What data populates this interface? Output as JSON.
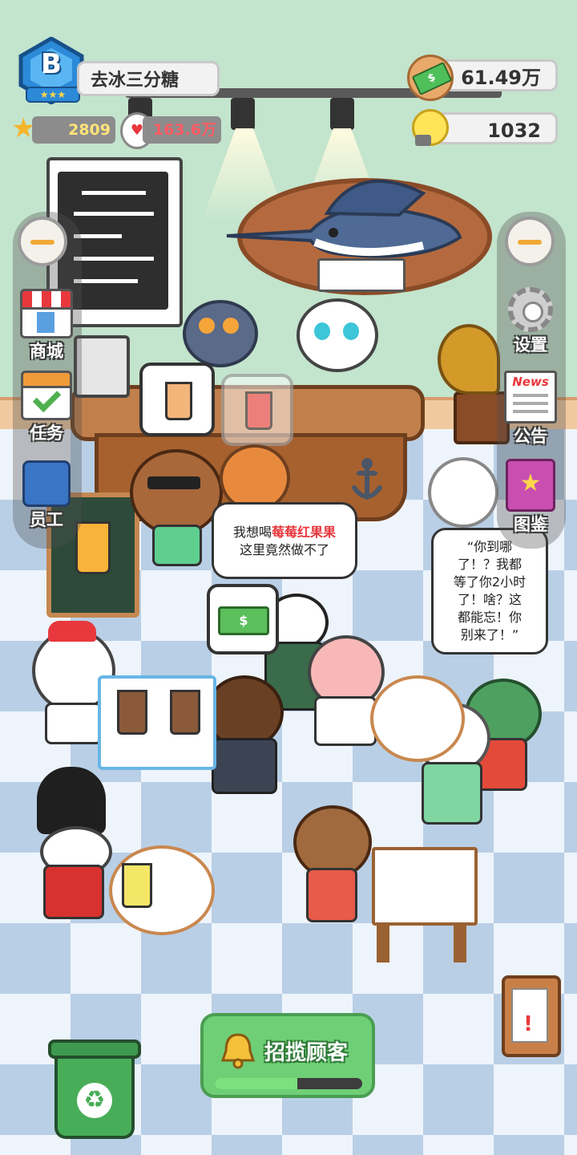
{
  "header": {
    "shop_rank": "B",
    "shop_name": "去冰三分糖",
    "stars": "2809",
    "popularity": "163.6万",
    "money": "61.49万",
    "ideas": "1032"
  },
  "left_menu": [
    {
      "label": "商城",
      "icon": "shop-icon"
    },
    {
      "label": "任务",
      "icon": "checklist-icon"
    },
    {
      "label": "员工",
      "icon": "staff-apron-icon"
    }
  ],
  "right_menu": [
    {
      "label": "设置",
      "icon": "gear-icon"
    },
    {
      "label": "公告",
      "icon": "news-icon",
      "icon_text": "News"
    },
    {
      "label": "图鉴",
      "icon": "album-icon"
    }
  ],
  "bubbles": {
    "monkey_line1_prefix": "我想喝",
    "monkey_line1_drink": "莓莓红果果",
    "monkey_line2": "这里竟然做不了",
    "alpaca_line1": "“你到哪",
    "alpaca_line2": "了！？我都",
    "alpaca_line3": "等了你2小时",
    "alpaca_line4": "了！啥？这",
    "alpaca_line5": "都能忘！你",
    "alpaca_line6": "别来了！”"
  },
  "recruit": {
    "label": "招揽顾客",
    "progress": 0.56
  },
  "colors": {
    "recruit_green": "#6fcf76",
    "highlight_red": "#e8383d",
    "wall_green": "#c3e4cd"
  }
}
